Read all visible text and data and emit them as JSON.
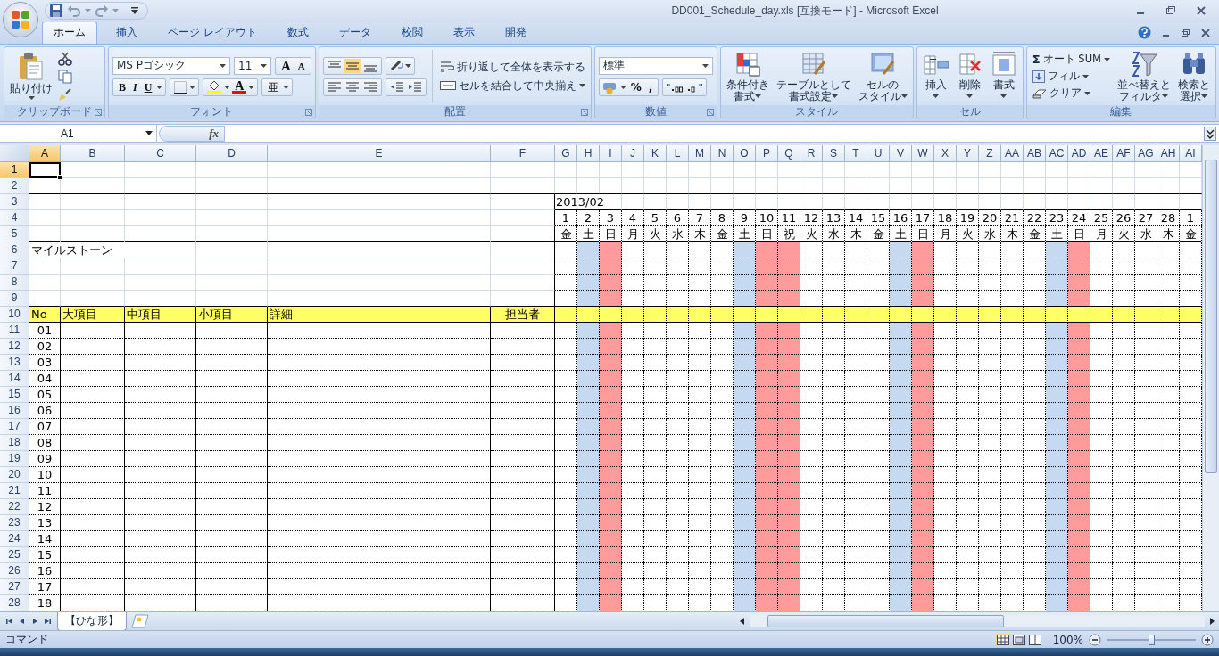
{
  "window": {
    "title": "DD001_Schedule_day.xls  [互換モード] - Microsoft Excel"
  },
  "ribbon_tabs": [
    {
      "label": "ホーム",
      "selected": true
    },
    {
      "label": "挿入",
      "selected": false
    },
    {
      "label": "ページ レイアウト",
      "selected": false
    },
    {
      "label": "数式",
      "selected": false
    },
    {
      "label": "データ",
      "selected": false
    },
    {
      "label": "校閲",
      "selected": false
    },
    {
      "label": "表示",
      "selected": false
    },
    {
      "label": "開発",
      "selected": false
    }
  ],
  "clipboard": {
    "label": "クリップボード",
    "paste": "貼り付け"
  },
  "font": {
    "label": "フォント",
    "family": "MS Pゴシック",
    "size": "11",
    "grow": "A",
    "shrink": "A",
    "bold": "B",
    "italic": "I",
    "underline": "U",
    "font_color": "A",
    "phonetic": "亜"
  },
  "alignment": {
    "label": "配置",
    "wrap": "折り返して全体を表示する",
    "merge": "セルを結合して中央揃え"
  },
  "number": {
    "label": "数値",
    "format": "標準",
    "percent": "%",
    "comma": ","
  },
  "styles": {
    "label": "スタイル",
    "buttons": [
      {
        "kind": "conditional",
        "lines": [
          "条件付き",
          "書式"
        ]
      },
      {
        "kind": "table",
        "lines": [
          "テーブルとして",
          "書式設定"
        ]
      },
      {
        "kind": "cell_style",
        "lines": [
          "セルの",
          "スタイル"
        ]
      }
    ]
  },
  "cells": {
    "label": "セル",
    "buttons": [
      {
        "kind": "insert",
        "label": "挿入"
      },
      {
        "kind": "delete",
        "label": "削除"
      },
      {
        "kind": "format",
        "label": "書式"
      }
    ]
  },
  "editing": {
    "label": "編集",
    "sum_symbol": "Σ",
    "autosum": "オート SUM",
    "fill": "フィル",
    "clear": "クリア",
    "sort": [
      "並べ替えと",
      "フィルタ"
    ],
    "find": [
      "検索と",
      "選択"
    ]
  },
  "formula_bar": {
    "name_box": "A1",
    "fx": "fx"
  },
  "sheet": {
    "columns": [
      {
        "label": "A",
        "selected": true
      },
      {
        "label": "B",
        "selected": false
      },
      {
        "label": "C",
        "selected": false
      },
      {
        "label": "D",
        "selected": false
      },
      {
        "label": "E",
        "selected": false
      },
      {
        "label": "F",
        "selected": false
      },
      {
        "label": "G",
        "selected": false
      },
      {
        "label": "H",
        "selected": false
      },
      {
        "label": "I",
        "selected": false
      },
      {
        "label": "J",
        "selected": false
      },
      {
        "label": "K",
        "selected": false
      },
      {
        "label": "L",
        "selected": false
      },
      {
        "label": "M",
        "selected": false
      },
      {
        "label": "N",
        "selected": false
      },
      {
        "label": "O",
        "selected": false
      },
      {
        "label": "P",
        "selected": false
      },
      {
        "label": "Q",
        "selected": false
      },
      {
        "label": "R",
        "selected": false
      },
      {
        "label": "S",
        "selected": false
      },
      {
        "label": "T",
        "selected": false
      },
      {
        "label": "U",
        "selected": false
      },
      {
        "label": "V",
        "selected": false
      },
      {
        "label": "W",
        "selected": false
      },
      {
        "label": "X",
        "selected": false
      },
      {
        "label": "Y",
        "selected": false
      },
      {
        "label": "Z",
        "selected": false
      },
      {
        "label": "AA",
        "selected": false
      },
      {
        "label": "AB",
        "selected": false
      },
      {
        "label": "AC",
        "selected": false
      },
      {
        "label": "AD",
        "selected": false
      },
      {
        "label": "AE",
        "selected": false
      },
      {
        "label": "AF",
        "selected": false
      },
      {
        "label": "AG",
        "selected": false
      },
      {
        "label": "AH",
        "selected": false
      },
      {
        "label": "AI",
        "selected": false
      }
    ],
    "rows": [
      {
        "label": "1",
        "selected": true
      },
      {
        "label": "2",
        "selected": false
      },
      {
        "label": "3",
        "selected": false
      },
      {
        "label": "4",
        "selected": false
      },
      {
        "label": "5",
        "selected": false
      },
      {
        "label": "6",
        "selected": false
      },
      {
        "label": "7",
        "selected": false
      },
      {
        "label": "8",
        "selected": false
      },
      {
        "label": "9",
        "selected": false
      },
      {
        "label": "10",
        "selected": false
      },
      {
        "label": "11",
        "selected": false
      },
      {
        "label": "12",
        "selected": false
      },
      {
        "label": "13",
        "selected": false
      },
      {
        "label": "14",
        "selected": false
      },
      {
        "label": "15",
        "selected": false
      },
      {
        "label": "16",
        "selected": false
      },
      {
        "label": "17",
        "selected": false
      },
      {
        "label": "18",
        "selected": false
      },
      {
        "label": "19",
        "selected": false
      },
      {
        "label": "20",
        "selected": false
      },
      {
        "label": "21",
        "selected": false
      },
      {
        "label": "22",
        "selected": false
      },
      {
        "label": "23",
        "selected": false
      },
      {
        "label": "24",
        "selected": false
      },
      {
        "label": "25",
        "selected": false
      },
      {
        "label": "26",
        "selected": false
      },
      {
        "label": "27",
        "selected": false
      },
      {
        "label": "28",
        "selected": false
      }
    ],
    "month": "2013/02",
    "milestone_label": "マイルストーン",
    "task_header": [
      "No",
      "大項目",
      "中項目",
      "小項目",
      "詳細",
      "担当者"
    ],
    "days": [
      {
        "date": "1",
        "weekday": "金",
        "kind": "weekday"
      },
      {
        "date": "2",
        "weekday": "土",
        "kind": "saturday"
      },
      {
        "date": "3",
        "weekday": "日",
        "kind": "sunday"
      },
      {
        "date": "4",
        "weekday": "月",
        "kind": "weekday"
      },
      {
        "date": "5",
        "weekday": "火",
        "kind": "weekday"
      },
      {
        "date": "6",
        "weekday": "水",
        "kind": "weekday"
      },
      {
        "date": "7",
        "weekday": "木",
        "kind": "weekday"
      },
      {
        "date": "8",
        "weekday": "金",
        "kind": "weekday"
      },
      {
        "date": "9",
        "weekday": "土",
        "kind": "saturday"
      },
      {
        "date": "10",
        "weekday": "日",
        "kind": "sunday"
      },
      {
        "date": "11",
        "weekday": "祝",
        "kind": "holiday"
      },
      {
        "date": "12",
        "weekday": "火",
        "kind": "weekday"
      },
      {
        "date": "13",
        "weekday": "水",
        "kind": "weekday"
      },
      {
        "date": "14",
        "weekday": "木",
        "kind": "weekday"
      },
      {
        "date": "15",
        "weekday": "金",
        "kind": "weekday"
      },
      {
        "date": "16",
        "weekday": "土",
        "kind": "saturday"
      },
      {
        "date": "17",
        "weekday": "日",
        "kind": "sunday"
      },
      {
        "date": "18",
        "weekday": "月",
        "kind": "weekday"
      },
      {
        "date": "19",
        "weekday": "火",
        "kind": "weekday"
      },
      {
        "date": "20",
        "weekday": "水",
        "kind": "weekday"
      },
      {
        "date": "21",
        "weekday": "木",
        "kind": "weekday"
      },
      {
        "date": "22",
        "weekday": "金",
        "kind": "weekday"
      },
      {
        "date": "23",
        "weekday": "土",
        "kind": "saturday"
      },
      {
        "date": "24",
        "weekday": "日",
        "kind": "sunday"
      },
      {
        "date": "25",
        "weekday": "月",
        "kind": "weekday"
      },
      {
        "date": "26",
        "weekday": "火",
        "kind": "weekday"
      },
      {
        "date": "27",
        "weekday": "水",
        "kind": "weekday"
      },
      {
        "date": "28",
        "weekday": "木",
        "kind": "weekday"
      },
      {
        "date": "1",
        "weekday": "金",
        "kind": "weekday"
      }
    ],
    "tasks": [
      {
        "no": "01"
      },
      {
        "no": "02"
      },
      {
        "no": "03"
      },
      {
        "no": "04"
      },
      {
        "no": "05"
      },
      {
        "no": "06"
      },
      {
        "no": "07"
      },
      {
        "no": "08"
      },
      {
        "no": "09"
      },
      {
        "no": "10"
      },
      {
        "no": "11"
      },
      {
        "no": "12"
      },
      {
        "no": "13"
      },
      {
        "no": "14"
      },
      {
        "no": "15"
      },
      {
        "no": "16"
      },
      {
        "no": "17"
      },
      {
        "no": "18"
      }
    ]
  },
  "sheet_tabs": [
    {
      "label": "【ひな形】",
      "selected": true
    }
  ],
  "status_bar": {
    "mode": "コマンド",
    "zoom": "100%",
    "zoom_slider": {
      "level": 0.5
    }
  }
}
